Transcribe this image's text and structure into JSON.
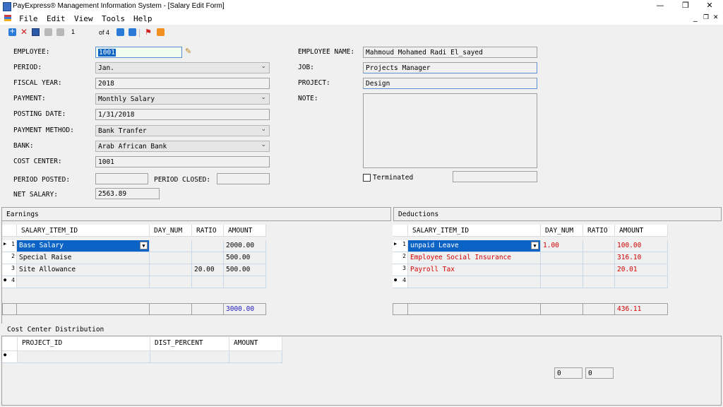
{
  "window": {
    "title": "PayExpress® Management Information System - [Salary Edit Form]",
    "controls": {
      "minimize": "—",
      "restore": "❐",
      "close": "✕"
    },
    "mdi_controls": {
      "minimize": "_",
      "restore": "❐",
      "close": "✕"
    }
  },
  "menu": [
    "File",
    "Edit",
    "View",
    "Tools",
    "Help"
  ],
  "toolbar": {
    "record_position": "1",
    "record_total": "of 4"
  },
  "form": {
    "employee_label": "EMPLOYEE:",
    "employee_value": "1001",
    "period_label": "PERIOD:",
    "period_value": "Jan.",
    "fiscal_year_label": "FISCAL YEAR:",
    "fiscal_year_value": "2018",
    "payment_label": "PAYMENT:",
    "payment_value": "Monthly Salary",
    "posting_date_label": "POSTING DATE:",
    "posting_date_value": "1/31/2018",
    "payment_method_label": "PAYMENT METHOD:",
    "payment_method_value": "Bank Tranfer",
    "bank_label": "BANK:",
    "bank_value": "Arab African Bank",
    "cost_center_label": "COST CENTER:",
    "cost_center_value": "1001",
    "period_posted_label": "PERIOD POSTED:",
    "period_posted_value": "",
    "period_closed_label": "PERIOD CLOSED:",
    "period_closed_value": "",
    "net_salary_label": "NET SALARY:",
    "net_salary_value": "2563.89",
    "employee_name_label": "EMPLOYEE NAME:",
    "employee_name_value": "Mahmoud Mohamed Radi El_sayed",
    "job_label": "JOB:",
    "job_value": "Projects Manager",
    "project_label": "PROJECT:",
    "project_value": "Design",
    "note_label": "NOTE:",
    "note_value": "",
    "terminated_label": "Terminated",
    "terminated_date": ""
  },
  "earnings": {
    "title": "Earnings",
    "columns": [
      "SALARY_ITEM_ID",
      "DAY_NUM",
      "RATIO",
      "AMOUNT"
    ],
    "rows": [
      {
        "num": "1",
        "item": "Base Salary",
        "day": "",
        "ratio": "",
        "amount": "2000.00"
      },
      {
        "num": "2",
        "item": "Special Raise",
        "day": "",
        "ratio": "",
        "amount": "500.00"
      },
      {
        "num": "3",
        "item": "Site Allowance",
        "day": "",
        "ratio": "20.00",
        "amount": "500.00"
      },
      {
        "num": "4",
        "item": "",
        "day": "",
        "ratio": "",
        "amount": ""
      }
    ],
    "total": "3000.00"
  },
  "deductions": {
    "title": "Deductions",
    "columns": [
      "SALARY_ITEM_ID",
      "DAY_NUM",
      "RATIO",
      "AMOUNT"
    ],
    "rows": [
      {
        "num": "1",
        "item": "unpaid Leave",
        "day": "1.00",
        "ratio": "",
        "amount": "100.00"
      },
      {
        "num": "2",
        "item": "Employee Social Insurance",
        "day": "",
        "ratio": "",
        "amount": "316.10"
      },
      {
        "num": "3",
        "item": "Payroll Tax",
        "day": "",
        "ratio": "",
        "amount": "20.01"
      },
      {
        "num": "4",
        "item": "",
        "day": "",
        "ratio": "",
        "amount": ""
      }
    ],
    "total": "436.11"
  },
  "cost_distribution": {
    "title": "Cost Center Distribution",
    "columns": [
      "PROJECT_ID",
      "DIST_PERCENT",
      "AMOUNT"
    ],
    "totals": [
      "0",
      "0"
    ]
  }
}
